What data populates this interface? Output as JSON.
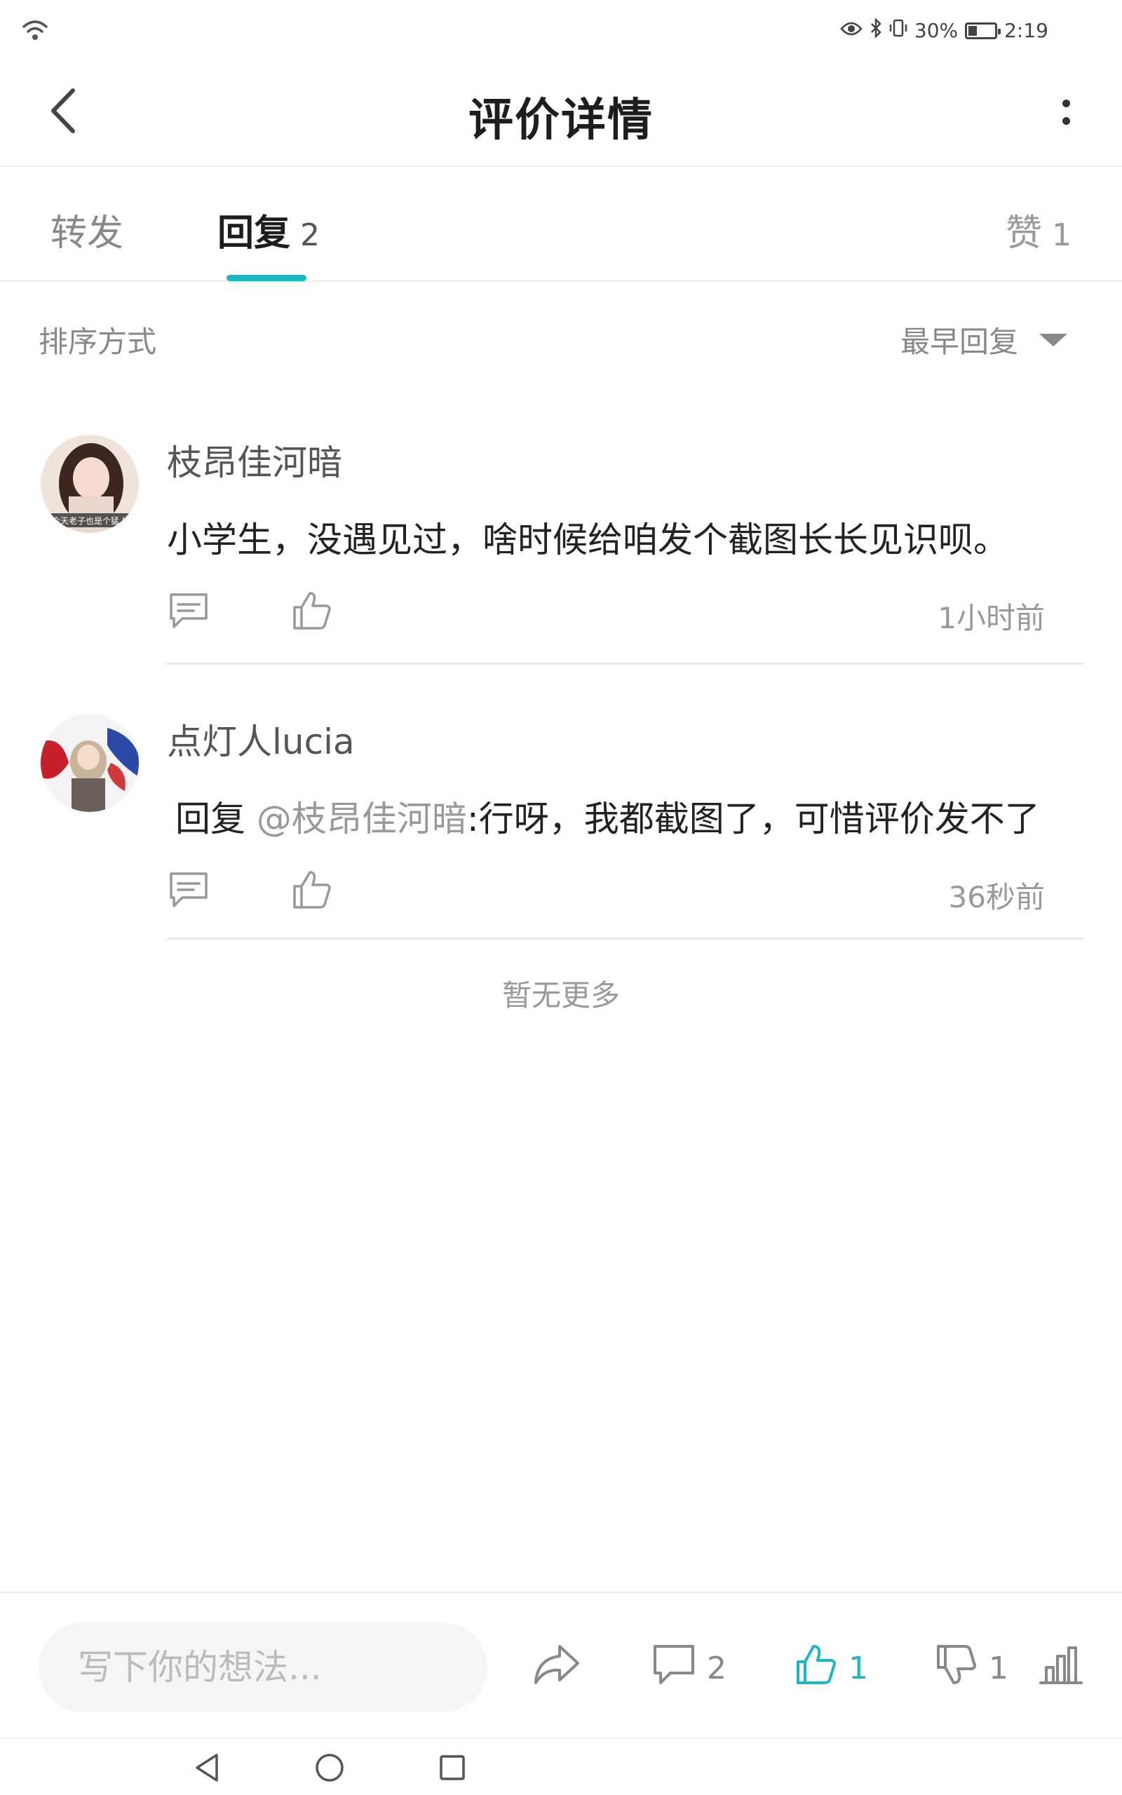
{
  "status_bar": {
    "battery_text": "30%",
    "battery_level": 0.3,
    "time": "2:19"
  },
  "header": {
    "title": "评价详情"
  },
  "tabs": [
    {
      "label": "转发",
      "count": ""
    },
    {
      "label": "回复",
      "count": "2"
    },
    {
      "label": "赞",
      "count": "1"
    }
  ],
  "sort": {
    "label": "排序方式",
    "selected": "最早回复"
  },
  "comments": [
    {
      "username": "枝昂佳河暗",
      "avatar_text": "今天老子也是个猛人",
      "content": "小学生，没遇见过，啥时候给咱发个截图长长见识呗。",
      "time": "1小时前"
    },
    {
      "username": "点灯人lucia",
      "reply_prefix": "回复 ",
      "mention": "@枝昂佳河暗",
      "content": ":行呀，我都截图了，可惜评价发不了",
      "time": "36秒前"
    }
  ],
  "no_more": "暂无更多",
  "bottom_bar": {
    "input_placeholder": "写下你的想法...",
    "comment_count": "2",
    "like_count": "1",
    "dislike_count": "1"
  },
  "colors": {
    "accent": "#1fb6c4",
    "text_primary": "#1d1d1d",
    "text_secondary": "#888888"
  }
}
